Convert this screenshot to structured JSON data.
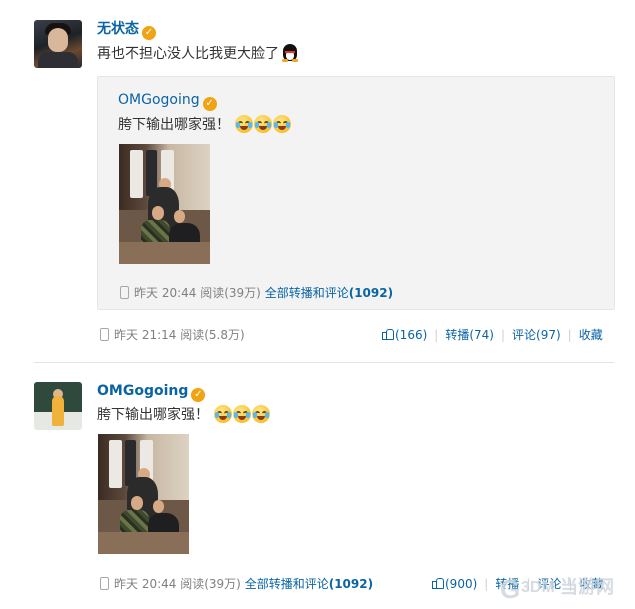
{
  "posts": [
    {
      "author": "无状态",
      "verified_icon": "verified-badge-icon",
      "text": "再也不担心没人比我更大脸了",
      "emoji": "qq-penguin-icon",
      "repost": {
        "author": "OMGogoing",
        "text": "胯下输出哪家强！",
        "emojis": [
          "laugh-cry-icon",
          "laugh-cry-icon",
          "laugh-cry-icon"
        ],
        "meta": {
          "time": "昨天 20:44",
          "reads": "阅读(39万)",
          "link": "全部转播和评论",
          "count": "(1092)"
        }
      },
      "meta": {
        "time": "昨天 21:14",
        "reads": "阅读(5.8万)"
      },
      "actions": {
        "like": "(166)",
        "forward": "转播(74)",
        "comment": "评论(97)",
        "favorite": "收藏"
      }
    },
    {
      "author": "OMGogoing",
      "verified_icon": "verified-badge-icon",
      "text": "胯下输出哪家强！",
      "emojis": [
        "laugh-cry-icon",
        "laugh-cry-icon",
        "laugh-cry-icon"
      ],
      "meta": {
        "time": "昨天 20:44",
        "reads": "阅读(39万)",
        "link": "全部转播和评论",
        "count": "(1092)"
      },
      "actions": {
        "like": "(900)",
        "forward": "转播",
        "comment": "评论",
        "favorite": "收藏"
      }
    }
  ],
  "watermark": {
    "logo": "G",
    "brand": "3DM",
    "site": "当游网"
  },
  "colors": {
    "link": "#0a64a4",
    "badge": "#f0a313",
    "meta": "#808080"
  }
}
